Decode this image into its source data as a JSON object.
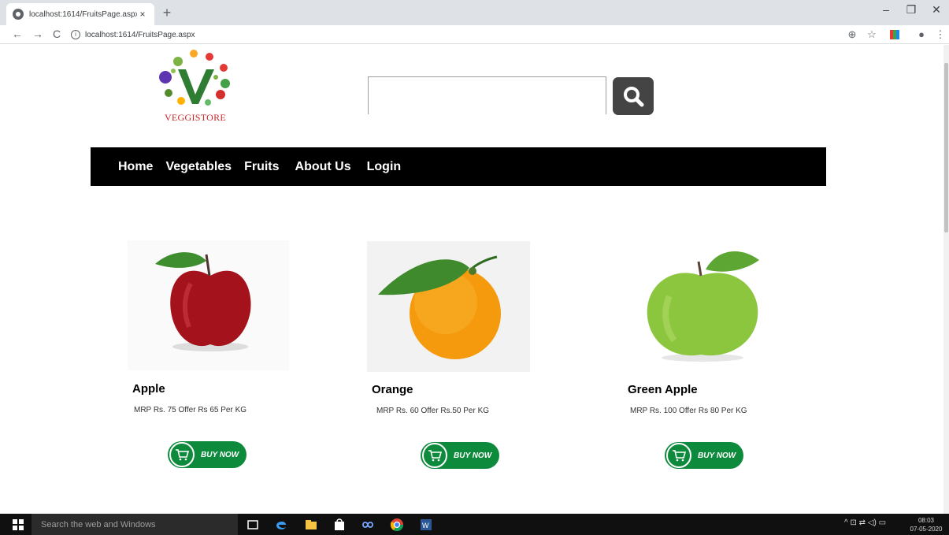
{
  "browser": {
    "tab_title": "localhost:1614/FruitsPage.aspx",
    "tab_close": "×",
    "new_tab": "+",
    "url": "localhost:1614/FruitsPage.aspx",
    "window_controls": {
      "minimize": "–",
      "maximize": "❐",
      "close": "✕"
    },
    "nav": {
      "back": "←",
      "forward": "→",
      "reload": "C"
    }
  },
  "site": {
    "logo_text": "VEGGISTORE",
    "search": {
      "value": "",
      "placeholder": ""
    },
    "nav_links": [
      "Home",
      "Vegetables",
      "Fruits",
      "About Us",
      "Login"
    ]
  },
  "products": [
    {
      "name": "Apple",
      "price": "MRP Rs. 75 Offer Rs 65 Per KG",
      "button": "BUY NOW",
      "image": "red-apple"
    },
    {
      "name": "Orange",
      "price": "MRP Rs. 60 Offer Rs.50 Per KG",
      "button": "BUY NOW",
      "image": "orange"
    },
    {
      "name": "Green Apple",
      "price": "MRP Rs. 100 Offer Rs 80 Per KG",
      "button": "BUY NOW",
      "image": "green-apple"
    }
  ],
  "taskbar": {
    "search_placeholder": "Search the web and Windows",
    "time": "08:03",
    "date": "07-05-2020"
  },
  "colors": {
    "navbar": "#000000",
    "buy_button": "#0e8a3c",
    "search_button": "#444444",
    "logo_text": "#c62828"
  }
}
